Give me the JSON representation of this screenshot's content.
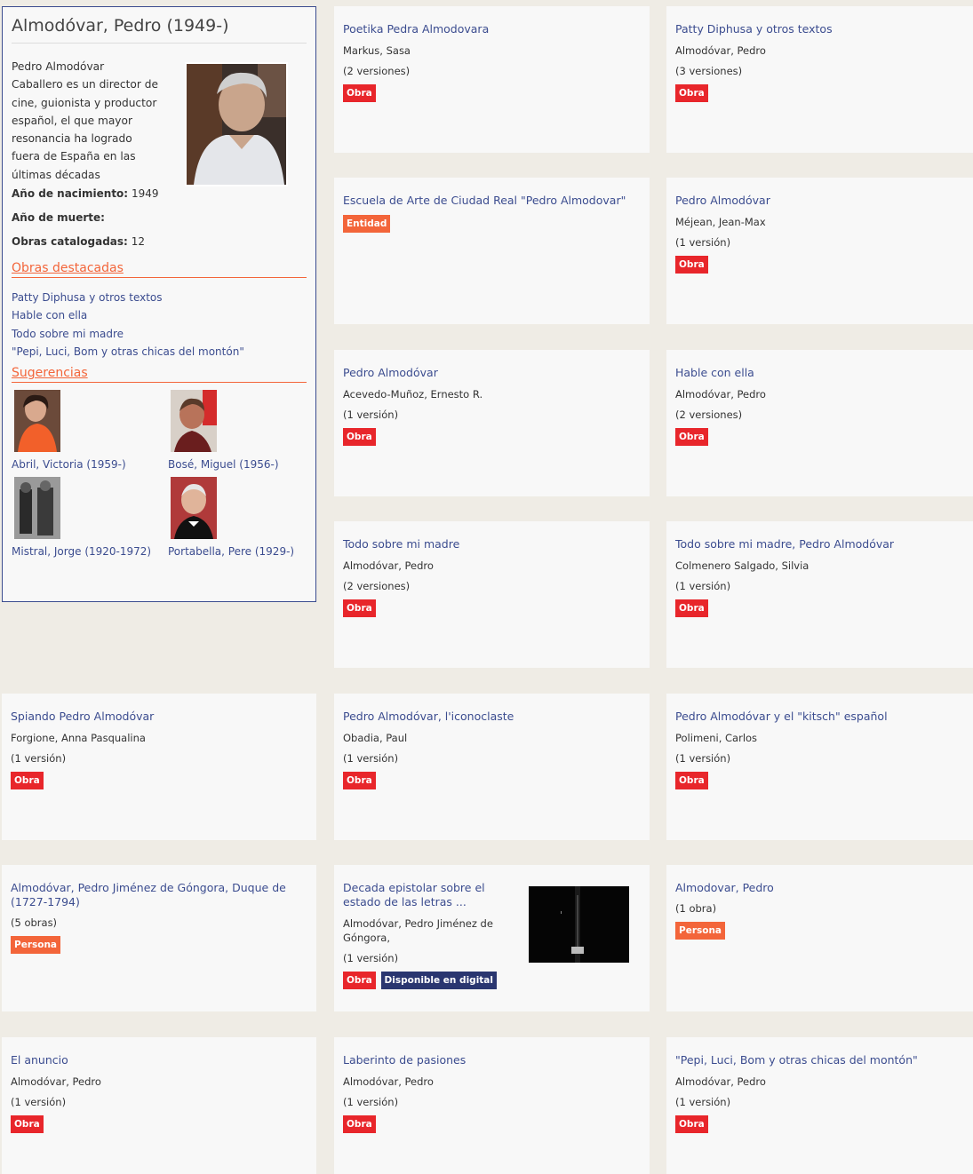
{
  "author": {
    "name": "Almodóvar, Pedro (1949-)",
    "bio": "Pedro Almodóvar Caballero es un director de cine, guionista y productor español, el que mayor resonancia ha logrado fuera de España en las últimas décadas",
    "birth_label": "Año de nacimiento:",
    "birth_value": "1949",
    "death_label": "Año de muerte:",
    "works_label": "Obras catalogadas:",
    "works_value": "12",
    "featured_title": "Obras destacadas",
    "featured": [
      "Patty Diphusa y otros textos",
      "Hable con ella",
      "Todo sobre mi madre",
      "\"Pepi, Luci, Bom y otras chicas del montón\""
    ],
    "suggestions_title": "Sugerencias",
    "suggestions": [
      "Abril, Victoria (1959-)",
      "Bosé, Miguel (1956-)",
      "Mistral, Jorge (1920-1972)",
      "Portabella, Pere (1929-)"
    ]
  },
  "badges": {
    "obra": "Obra",
    "entidad": "Entidad",
    "persona": "Persona",
    "digital": "Disponible en digital"
  },
  "cards": [
    {
      "title": "Poetika Pedra Almodovara",
      "author": "Markus, Sasa",
      "versions": "(2 versiones)"
    },
    {
      "title": "Patty Diphusa y otros textos",
      "author": "Almodóvar, Pedro",
      "versions": "(3 versiones)"
    },
    {
      "title": "Escuela de Arte de Ciudad Real \"Pedro Almodovar\""
    },
    {
      "title": "Pedro Almodóvar",
      "author": "Méjean, Jean-Max",
      "versions": "(1 versión)"
    },
    {
      "title": "Pedro Almodóvar",
      "author": "Acevedo-Muñoz, Ernesto R.",
      "versions": "(1 versión)"
    },
    {
      "title": "Hable con ella",
      "author": "Almodóvar, Pedro",
      "versions": "(2 versiones)"
    },
    {
      "title": "Todo sobre mi madre",
      "author": "Almodóvar, Pedro",
      "versions": "(2 versiones)"
    },
    {
      "title": "Todo sobre mi madre, Pedro Almodóvar",
      "author": "Colmenero Salgado, Silvia",
      "versions": "(1 versión)"
    },
    {
      "title": "Spiando Pedro Almodóvar",
      "author": "Forgione, Anna Pasqualina",
      "versions": "(1 versión)"
    },
    {
      "title": "Pedro Almodóvar, l'iconoclaste",
      "author": "Obadia, Paul",
      "versions": "(1 versión)"
    },
    {
      "title": "Pedro Almodóvar y el \"kitsch\" español",
      "author": "Polimeni, Carlos",
      "versions": "(1 versión)"
    },
    {
      "title": "Almodóvar, Pedro Jiménez de Góngora, Duque de (1727-1794)",
      "versions": "(5 obras)"
    },
    {
      "title": "Decada epistolar sobre el estado de las letras ...",
      "author": "Almodóvar, Pedro Jiménez de Góngora,",
      "versions": "(1 versión)"
    },
    {
      "title": "Almodovar, Pedro",
      "versions": "(1 obra)"
    },
    {
      "title": "El anuncio",
      "author": "Almodóvar, Pedro",
      "versions": "(1 versión)"
    },
    {
      "title": "Laberinto de pasiones",
      "author": "Almodóvar, Pedro",
      "versions": "(1 versión)"
    },
    {
      "title": "\"Pepi, Luci, Bom y otras chicas del montón\"",
      "author": "Almodóvar, Pedro",
      "versions": "(1 versión)"
    }
  ]
}
